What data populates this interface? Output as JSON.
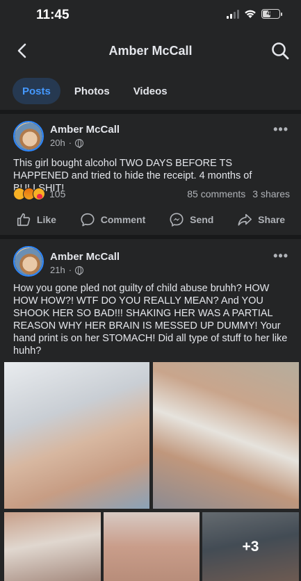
{
  "status_bar": {
    "time": "11:45",
    "battery": "43",
    "battery_level": 0.43
  },
  "header": {
    "title": "Amber McCall",
    "back_icon": "chevron-left-icon",
    "search_icon": "search-icon"
  },
  "tabs": [
    {
      "label": "Posts",
      "active": true
    },
    {
      "label": "Photos",
      "active": false
    },
    {
      "label": "Videos",
      "active": false
    }
  ],
  "posts": [
    {
      "author": "Amber McCall",
      "time": "20h",
      "more": "•••",
      "text": "This girl bought alcohol TWO DAYS BEFORE TS HAPPENED and tried to hide the receipt. 4 months of BULLSHIT!",
      "reactions": [
        "sad",
        "angry",
        "care"
      ],
      "reaction_count": "105",
      "comments": "85 comments",
      "shares": "3 shares",
      "actions": [
        "Like",
        "Comment",
        "Send",
        "Share"
      ]
    },
    {
      "author": "Amber McCall",
      "time": "21h",
      "more": "•••",
      "text": "How you gone pled not guilty of child abuse bruhh? HOW HOW HOW?! WTF DO YOU REALLY MEAN? And YOU SHOOK HER SO BAD!!! SHAKING HER WAS A PARTIAL REASON WHY HER BRAIN IS MESSED UP DUMMY! Your hand print is on her STOMACH! Did all type of stuff to her like huhh?",
      "photos_more": "+3"
    }
  ],
  "colors": {
    "background": "#242526",
    "divider": "#18191a",
    "accent": "#4599ff",
    "active_tab_bg": "#263951",
    "text_primary": "#e4e6eb",
    "text_secondary": "#b0b3b8"
  }
}
